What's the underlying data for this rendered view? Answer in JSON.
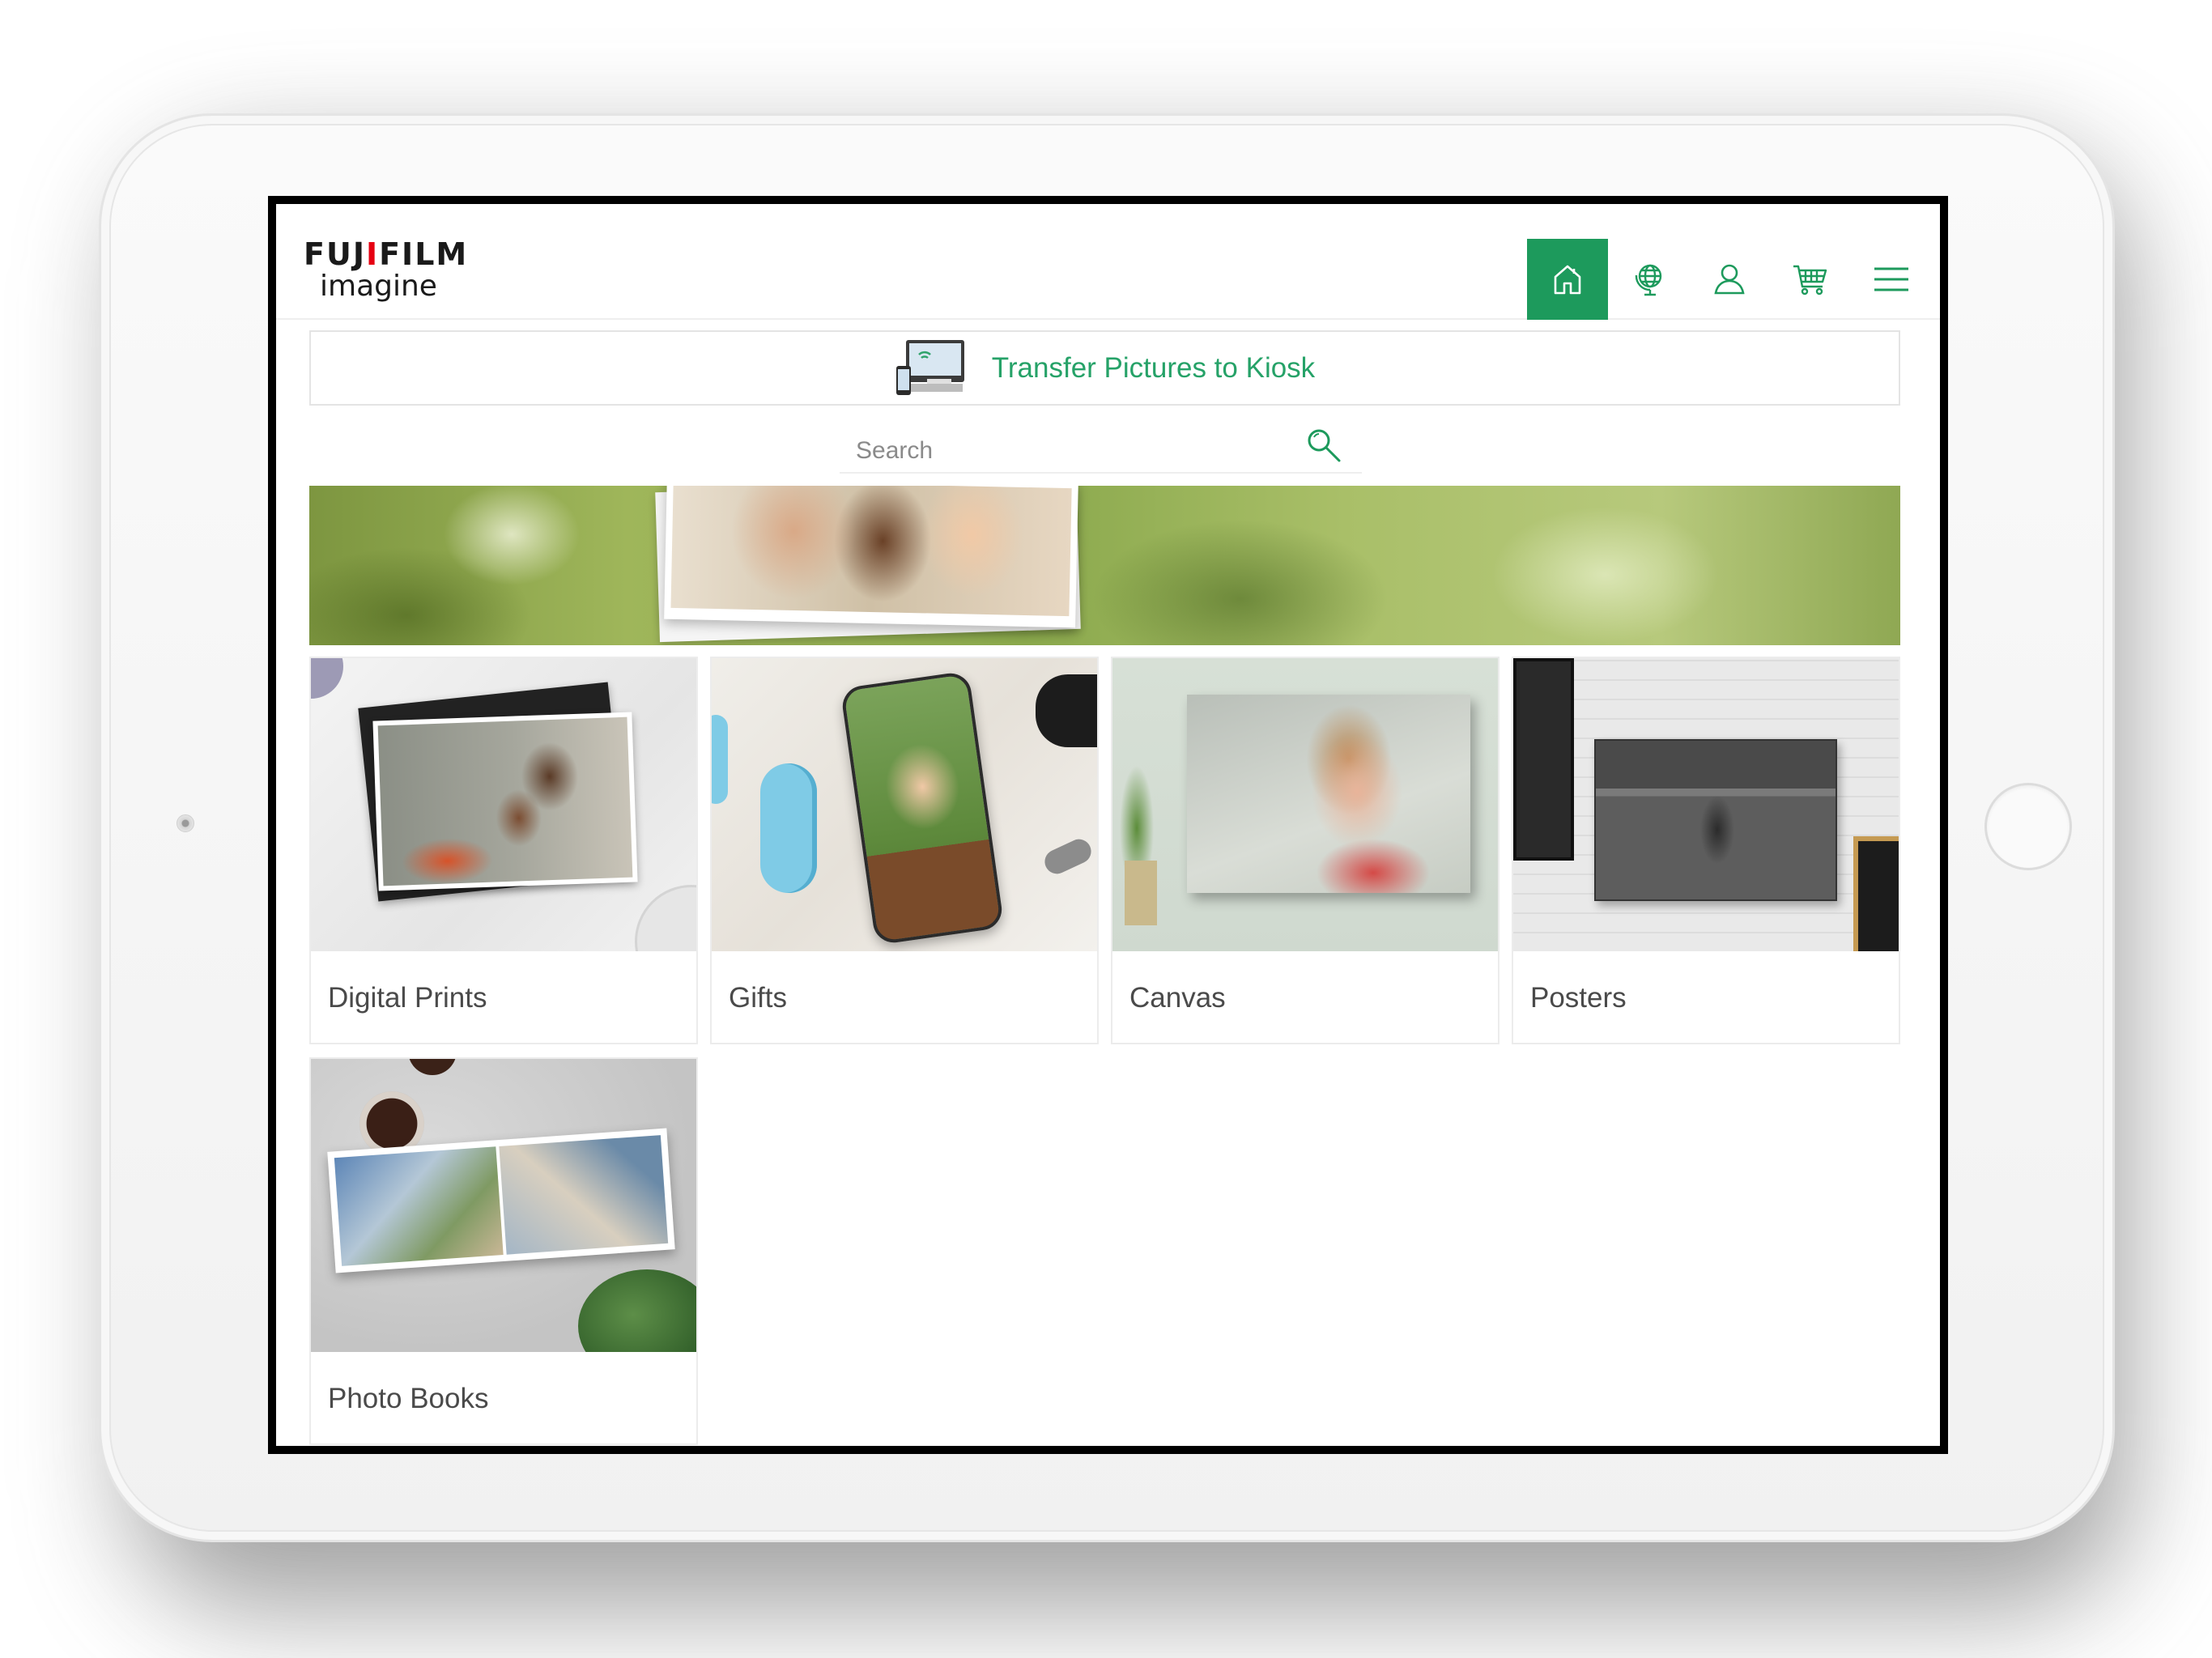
{
  "app": {
    "brand_name": "FUJIFILM",
    "brand_sub": "imagine"
  },
  "nav": {
    "items": [
      {
        "id": "home",
        "icon": "home-icon",
        "active": true
      },
      {
        "id": "globe",
        "icon": "globe-icon",
        "active": false
      },
      {
        "id": "account",
        "icon": "user-icon",
        "active": false
      },
      {
        "id": "cart",
        "icon": "cart-icon",
        "active": false
      },
      {
        "id": "menu",
        "icon": "hamburger-menu-icon",
        "active": false
      }
    ]
  },
  "transfer": {
    "label": "Transfer Pictures to Kiosk",
    "icon": "kiosk-transfer-icon"
  },
  "search": {
    "placeholder": "Search",
    "value": "",
    "icon": "search-icon"
  },
  "banner": {
    "image": "hero-banner-family-photo"
  },
  "products": [
    {
      "label": "Digital Prints",
      "image": "digital-prints-image"
    },
    {
      "label": "Gifts",
      "image": "gifts-image"
    },
    {
      "label": "Canvas",
      "image": "canvas-image"
    },
    {
      "label": "Posters",
      "image": "posters-image"
    },
    {
      "label": "Photo Books",
      "image": "photo-books-image"
    }
  ],
  "colors": {
    "accent": "#1d9a5c",
    "accent_text": "#26a268",
    "brand_red": "#e60012",
    "label_text": "#4a4a4a"
  }
}
